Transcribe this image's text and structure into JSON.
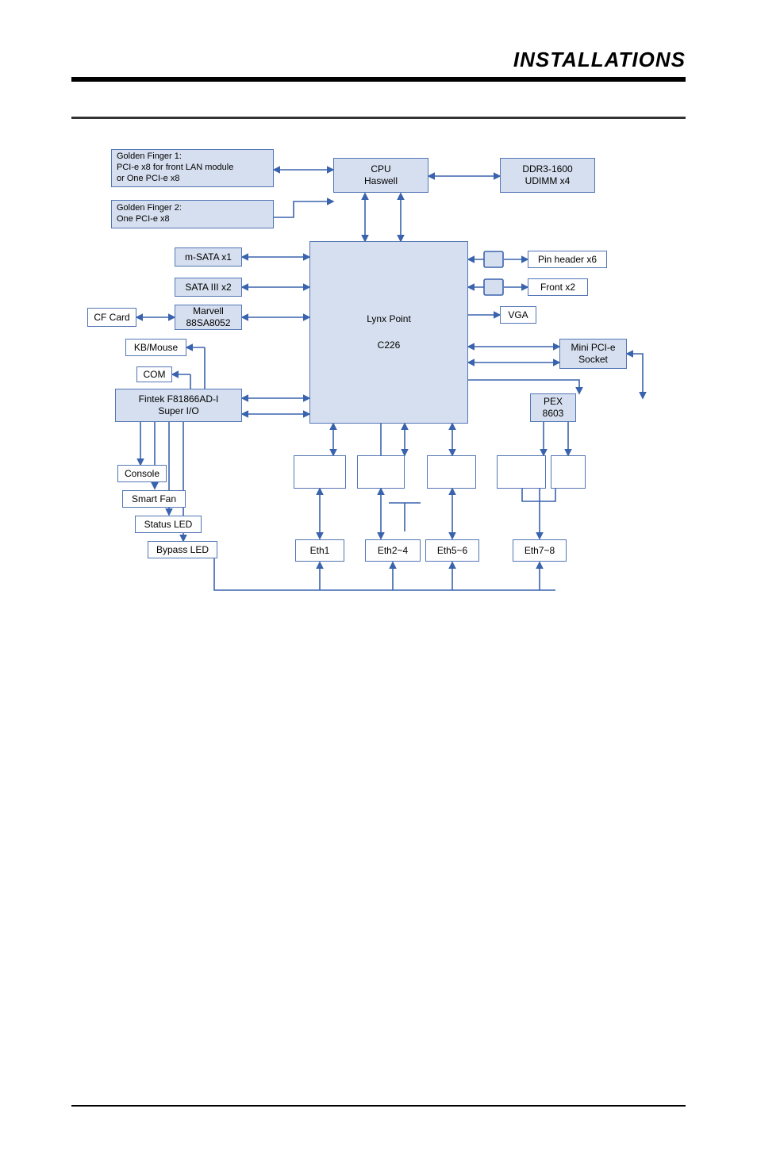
{
  "page": {
    "header_title": "INSTALLATIONS"
  },
  "diagram": {
    "golden_finger_1": "Golden Finger 1:\nPCI-e x8 for front LAN module\nor One PCI-e x8",
    "golden_finger_2": "Golden Finger 2:\nOne PCI-e x8",
    "cpu_l1": "CPU",
    "cpu_l2": "Haswell",
    "ddr_l1": "DDR3-1600",
    "ddr_l2": "UDIMM x4",
    "msata": "m-SATA x1",
    "sata": "SATA III x2",
    "cfcard": "CF Card",
    "marvell_l1": "Marvell",
    "marvell_l2": "88SA8052",
    "kbmouse": "KB/Mouse",
    "com": "COM",
    "fintek_l1": "Fintek F81866AD-I",
    "fintek_l2": "Super I/O",
    "console": "Console",
    "smartfan": "Smart Fan",
    "statusled": "Status LED",
    "bypassled": "Bypass LED",
    "lynx_l1": "Lynx Point",
    "lynx_l2": "C226",
    "pinheader": "Pin header x6",
    "front": "Front x2",
    "vga": "VGA",
    "mini_l1": "Mini PCI-e",
    "mini_l2": "Socket",
    "pex_l1": "PEX",
    "pex_l2": "8603",
    "eth1": "Eth1",
    "eth24": "Eth2~4",
    "eth56": "Eth5~6",
    "eth78": "Eth7~8"
  }
}
